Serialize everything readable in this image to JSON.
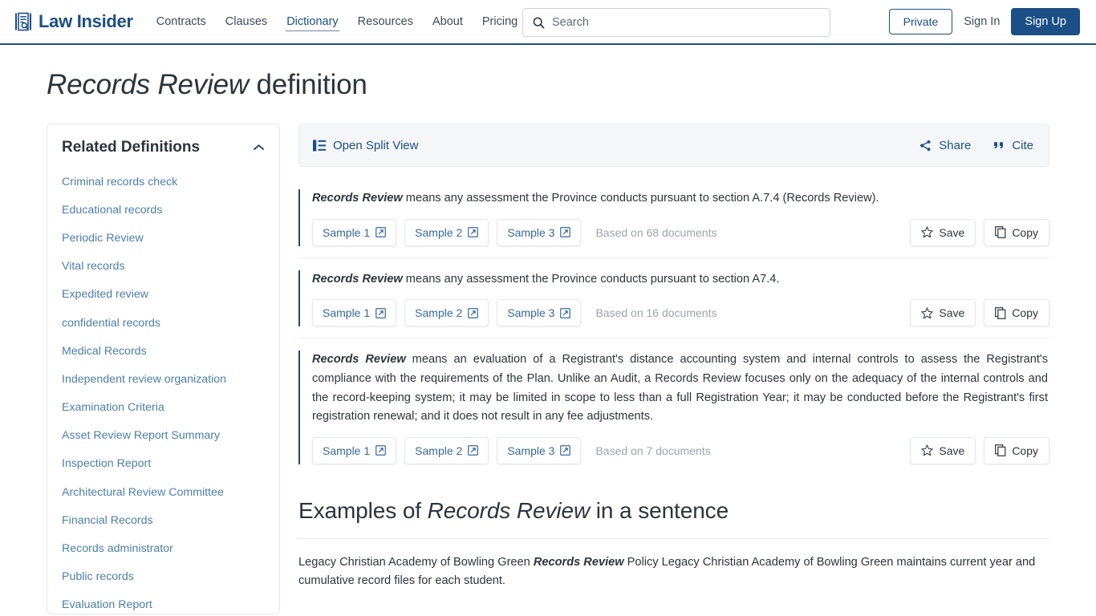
{
  "header": {
    "brand": "Law Insider",
    "brand_icon": "document-search-icon",
    "nav": [
      {
        "label": "Contracts",
        "active": false
      },
      {
        "label": "Clauses",
        "active": false
      },
      {
        "label": "Dictionary",
        "active": true
      },
      {
        "label": "Resources",
        "active": false
      },
      {
        "label": "About",
        "active": false
      },
      {
        "label": "Pricing",
        "active": false
      }
    ],
    "search": {
      "placeholder": "Search",
      "value": "",
      "icon": "search-icon"
    },
    "private_label": "Private",
    "signin_label": "Sign In",
    "signup_label": "Sign Up",
    "accent_color": "#1b4f86"
  },
  "page": {
    "term": "Records Review",
    "title_suffix": " definition"
  },
  "sidebar": {
    "title": "Related Definitions",
    "collapse_icon": "chevron-up-icon",
    "items": [
      {
        "label": "Criminal records check"
      },
      {
        "label": "Educational records"
      },
      {
        "label": "Periodic Review"
      },
      {
        "label": "Vital records"
      },
      {
        "label": "Expedited review"
      },
      {
        "label": "confidential records"
      },
      {
        "label": "Medical Records"
      },
      {
        "label": "Independent review organization"
      },
      {
        "label": "Examination Criteria"
      },
      {
        "label": "Asset Review Report Summary"
      },
      {
        "label": "Inspection Report"
      },
      {
        "label": "Architectural Review Committee"
      },
      {
        "label": "Financial Records"
      },
      {
        "label": "Records administrator"
      },
      {
        "label": "Public records"
      },
      {
        "label": "Evaluation Report"
      }
    ],
    "link_color": "#4d7ea8"
  },
  "toolbar": {
    "split_view_label": "Open Split View",
    "split_view_icon": "split-view-icon",
    "share_label": "Share",
    "share_icon": "share-icon",
    "cite_label": "Cite",
    "cite_icon": "quote-icon"
  },
  "definitions": [
    {
      "term": "Records Review",
      "body": " means any assessment the Province conducts pursuant to section A.7.4 (Records Review).",
      "samples": [
        {
          "label": "Sample 1",
          "icon": "external-link-icon"
        },
        {
          "label": "Sample 2",
          "icon": "external-link-icon"
        },
        {
          "label": "Sample 3",
          "icon": "external-link-icon"
        }
      ],
      "doc_count": "Based on 68 documents",
      "save_label": "Save",
      "save_icon": "star-icon",
      "copy_label": "Copy",
      "copy_icon": "copy-icon"
    },
    {
      "term": "Records Review",
      "body": " means any assessment the Province conducts pursuant to section A7.4.",
      "samples": [
        {
          "label": "Sample 1",
          "icon": "external-link-icon"
        },
        {
          "label": "Sample 2",
          "icon": "external-link-icon"
        },
        {
          "label": "Sample 3",
          "icon": "external-link-icon"
        }
      ],
      "doc_count": "Based on 16 documents",
      "save_label": "Save",
      "save_icon": "star-icon",
      "copy_label": "Copy",
      "copy_icon": "copy-icon"
    },
    {
      "term": "Records Review",
      "body": " means an evaluation of a Registrant's distance accounting system and internal controls to assess the Registrant's compliance with the requirements of the Plan. Unlike an Audit, a Records Review focuses only on the adequacy of the internal controls and the record-keeping system; it may be limited in scope to less than a full Registration Year; it may be conducted before the Registrant's first registration renewal; and it does not result in any fee adjustments.",
      "samples": [
        {
          "label": "Sample 1",
          "icon": "external-link-icon"
        },
        {
          "label": "Sample 2",
          "icon": "external-link-icon"
        },
        {
          "label": "Sample 3",
          "icon": "external-link-icon"
        }
      ],
      "doc_count": "Based on 7 documents",
      "save_label": "Save",
      "save_icon": "star-icon",
      "copy_label": "Copy",
      "copy_icon": "copy-icon"
    }
  ],
  "examples": {
    "title_prefix": "Examples of ",
    "title_term": "Records Review",
    "title_suffix": " in a sentence",
    "entries": [
      {
        "before": "Legacy Christian Academy of Bowling Green ",
        "term": "Records Review",
        "after": " Policy Legacy Christian Academy of Bowling Green maintains current year and cumulative record files for each student."
      }
    ]
  }
}
